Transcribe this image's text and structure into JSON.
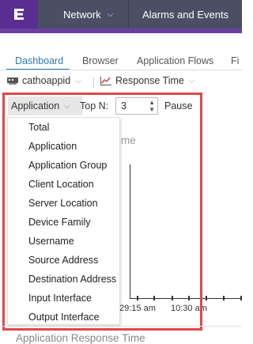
{
  "header": {
    "network_label": "Network",
    "alarms_label": "Alarms and Events"
  },
  "tabs": [
    {
      "label": "Dashboard",
      "active": true
    },
    {
      "label": "Browser"
    },
    {
      "label": "Application Flows"
    },
    {
      "label": "Fi"
    }
  ],
  "toolbar": {
    "site_label": "cathoappid",
    "metric_label": "Response Time"
  },
  "controls": {
    "group_by_value": "Application",
    "topn_label": "Top N:",
    "topn_value": "3",
    "pause_label": "Pause"
  },
  "dropdown": {
    "options": [
      "Total",
      "Application",
      "Application Group",
      "Client Location",
      "Server Location",
      "Device Family",
      "Username",
      "Source Address",
      "Destination Address",
      "Input Interface",
      "Output Interface"
    ]
  },
  "chart": {
    "partial_title": "ime",
    "x_ticks": [
      "29:15 am",
      "10:30 am"
    ]
  },
  "bottom": {
    "title": "Application Response Time"
  },
  "colors": {
    "header_bg": "#4b4f63",
    "logo_bg": "#5a2d91",
    "accent": "#2a7ab8",
    "highlight": "#e04848"
  }
}
